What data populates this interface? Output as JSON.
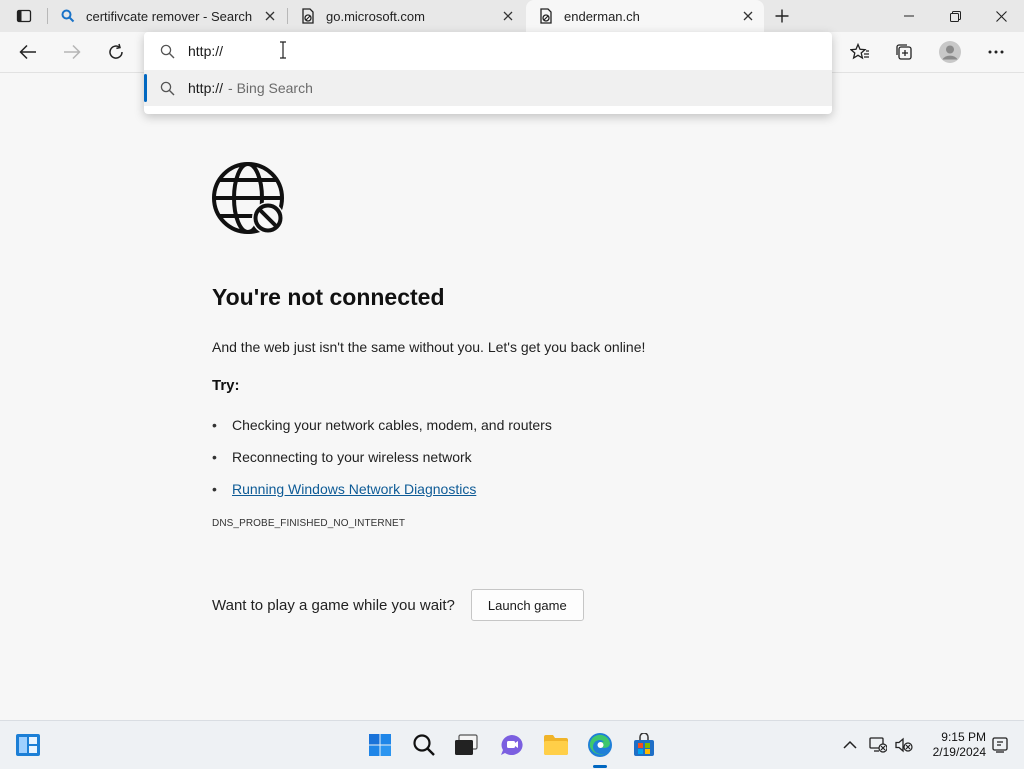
{
  "tabs": [
    {
      "title": "certifivcate remover - Search",
      "favicon": "search-icon"
    },
    {
      "title": "go.microsoft.com",
      "favicon": "broken-page-icon"
    },
    {
      "title": "enderman.ch",
      "favicon": "broken-page-icon",
      "active": true
    }
  ],
  "omnibox": {
    "value": "http://",
    "suggestion": {
      "main": "http://",
      "sub": "- Bing Search"
    }
  },
  "error_page": {
    "title": "You're not connected",
    "description": "And the web just isn't the same without you. Let's get you back online!",
    "try_label": "Try:",
    "suggestions": [
      "Checking your network cables, modem, and routers",
      "Reconnecting to your wireless network",
      "Running Windows Network Diagnostics"
    ],
    "error_code": "DNS_PROBE_FINISHED_NO_INTERNET",
    "game_prompt": "Want to play a game while you wait?",
    "launch_button": "Launch game"
  },
  "taskbar": {
    "time": "9:15 PM",
    "date": "2/19/2024"
  },
  "colors": {
    "accent": "#0067c0",
    "link": "#0e5b96"
  }
}
